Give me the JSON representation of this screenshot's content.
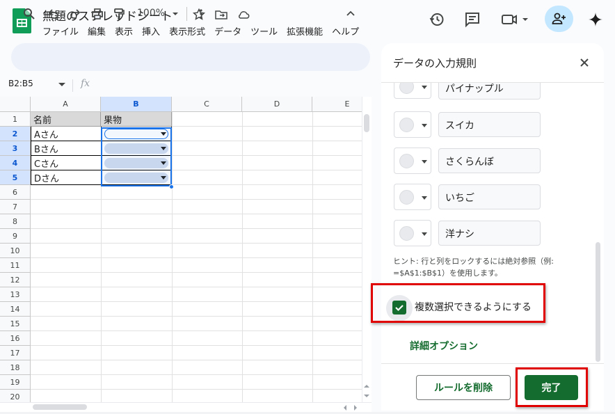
{
  "app": {
    "doc_title": "無題のスプレッドシート",
    "menus": [
      "ファイル",
      "編集",
      "表示",
      "挿入",
      "表示形式",
      "データ",
      "ツール",
      "拡張機能",
      "ヘルプ"
    ]
  },
  "toolbar": {
    "zoom": "100%"
  },
  "formula_bar": {
    "name_box": "B2:B5",
    "fx": "fx"
  },
  "grid": {
    "columns": [
      "A",
      "B",
      "C",
      "D",
      "E"
    ],
    "rows": [
      "1",
      "2",
      "3",
      "4",
      "5",
      "6",
      "7",
      "8",
      "9",
      "10",
      "11",
      "12",
      "13",
      "14",
      "15",
      "16",
      "17",
      "18",
      "19",
      "20"
    ],
    "header_row": [
      "名前",
      "果物"
    ],
    "names": [
      "Aさん",
      "Bさん",
      "Cさん",
      "Dさん"
    ]
  },
  "panel": {
    "title": "データの入力規則",
    "options": [
      "パイナップル",
      "スイカ",
      "さくらんぼ",
      "いちご",
      "洋ナシ"
    ],
    "hint": "ヒント: 行と列をロックするには絶対参照（例: =$A$1:$B$1）を使用します。",
    "multi_select_label": "複数選択できるようにする",
    "advanced_options": "詳細オプション",
    "remove_button": "ルールを削除",
    "done_button": "完了"
  },
  "colors": {
    "accent_green": "#146c2e",
    "selection_blue": "#1a73e8",
    "highlight_red": "#e00000"
  }
}
